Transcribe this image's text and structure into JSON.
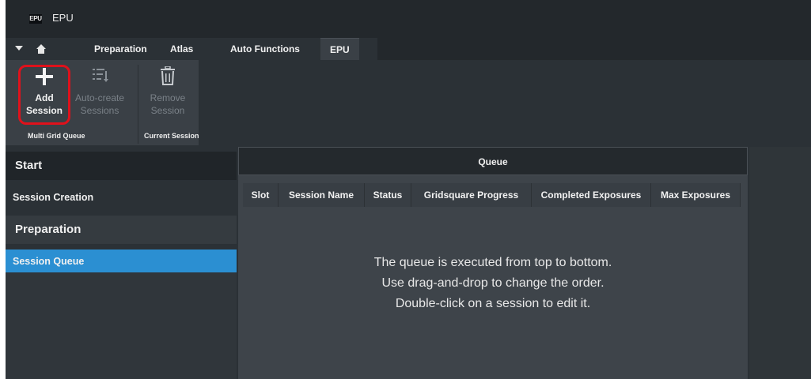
{
  "app": {
    "logo": "EPU",
    "title": "EPU"
  },
  "tabs": [
    {
      "label": "Preparation"
    },
    {
      "label": "Atlas"
    },
    {
      "label": "Auto Functions"
    },
    {
      "label": "EPU"
    }
  ],
  "ribbon": {
    "add_session": {
      "line1": "Add",
      "line2": "Session"
    },
    "auto_create": {
      "line1": "Auto-create",
      "line2": "Sessions"
    },
    "remove_session": {
      "line1": "Remove",
      "line2": "Session"
    },
    "groups": {
      "multi_grid_queue": "Multi Grid Queue",
      "current_session": "Current Session"
    }
  },
  "nav": {
    "start_header": "Start",
    "session_creation": "Session Creation",
    "preparation_header": "Preparation",
    "session_queue": "Session Queue"
  },
  "queue": {
    "title": "Queue",
    "columns": [
      "Slot",
      "Session Name",
      "Status",
      "Gridsquare Progress",
      "Completed Exposures",
      "Max Exposures"
    ],
    "empty_lines": [
      "The queue is executed from top to bottom.",
      "Use drag-and-drop to change the order.",
      "Double-click on a session to edit it."
    ]
  },
  "colors": {
    "accent": "#2b8fd2",
    "highlight_ring": "#e0111b",
    "background": "#2b3136"
  }
}
